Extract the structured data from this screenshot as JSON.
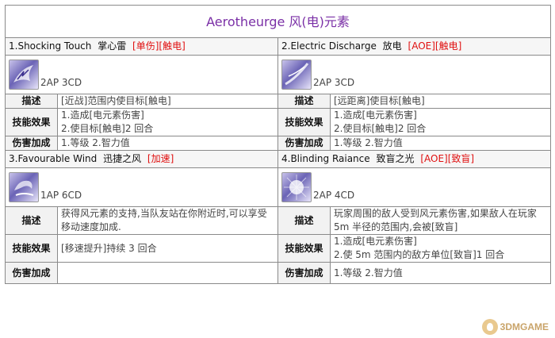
{
  "title": "Aerotheurge  风(电)元素",
  "skills": [
    {
      "name": "1.Shocking Touch",
      "cn": "掌心雷",
      "tag": "[单伤][触电]",
      "cost": "2AP 3CD",
      "icon": "shocking-touch-icon",
      "desc": "[近战]范围内使目标[触电]",
      "effects": [
        "1.造成[电元素伤害]",
        "2.使目标[触电]2 回合"
      ],
      "damage": "1.等级  2.智力值"
    },
    {
      "name": "2.Electric Discharge",
      "cn": "放电",
      "tag": "[AOE][触电]",
      "cost": "2AP 3CD",
      "icon": "electric-discharge-icon",
      "desc": "[远距离]使目标[触电]",
      "effects": [
        "1.造成[电元素伤害]",
        "2.使目标[触电]2 回合"
      ],
      "damage": "1.等级  2.智力值"
    },
    {
      "name": "3.Favourable Wind",
      "cn": "迅捷之风",
      "tag": "[加速]",
      "cost": "1AP 6CD",
      "icon": "favourable-wind-icon",
      "desc": "获得风元素的支持,当队友站在你附近时,可以享受移动速度加成.",
      "effects": [
        "[移速提升]持续 3 回合"
      ],
      "damage": ""
    },
    {
      "name": "4.Blinding Raiance",
      "cn": "致盲之光",
      "tag": "[AOE][致盲]",
      "cost": "2AP 4CD",
      "icon": "blinding-radiance-icon",
      "desc": "玩家周围的敌人受到风元素伤害,如果敌人在玩家 5m 半径的范围内,会被[致盲]",
      "effects": [
        "1.造成[电元素伤害]",
        "2.使 5m 范围内的敌方单位[致盲]1 回合"
      ],
      "damage": "1.等级  2.智力值"
    }
  ],
  "labels": {
    "desc": "描述",
    "effect": "技能效果",
    "damage": "伤害加成"
  },
  "watermark": "3DMGAME"
}
